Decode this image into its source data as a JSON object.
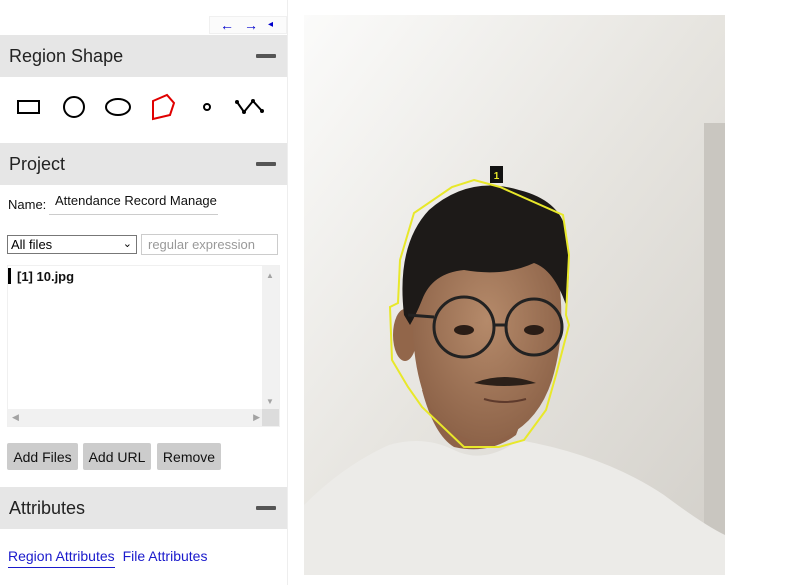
{
  "nav": {
    "prev_symbol": "←",
    "next_symbol": "→",
    "toggle_symbol": "◂"
  },
  "region_shape": {
    "title": "Region Shape",
    "shapes": [
      "rectangle",
      "circle",
      "ellipse",
      "polygon",
      "point",
      "polyline"
    ],
    "selected": "polygon"
  },
  "project": {
    "title": "Project",
    "name_label": "Name:",
    "name_value": "Attendance Record Manage",
    "filter_selected": "All files",
    "regex_placeholder": "regular expression",
    "files": [
      {
        "index": "[1]",
        "name": "10.jpg",
        "label": "[1] 10.jpg"
      }
    ],
    "buttons": {
      "add_files": "Add Files",
      "add_url": "Add URL",
      "remove": "Remove"
    }
  },
  "attributes": {
    "title": "Attributes",
    "tabs": {
      "region": "Region Attributes",
      "file": "File Attributes"
    },
    "active_tab": "region"
  },
  "canvas": {
    "region_label": "1",
    "region_color": "#e8e82a",
    "label_bg": "#111111"
  },
  "colors": {
    "accent_link": "#1a1acc",
    "panel_header_bg": "#e6e6e6",
    "button_bg": "#cccccc",
    "polygon_icon": "#e00000"
  }
}
